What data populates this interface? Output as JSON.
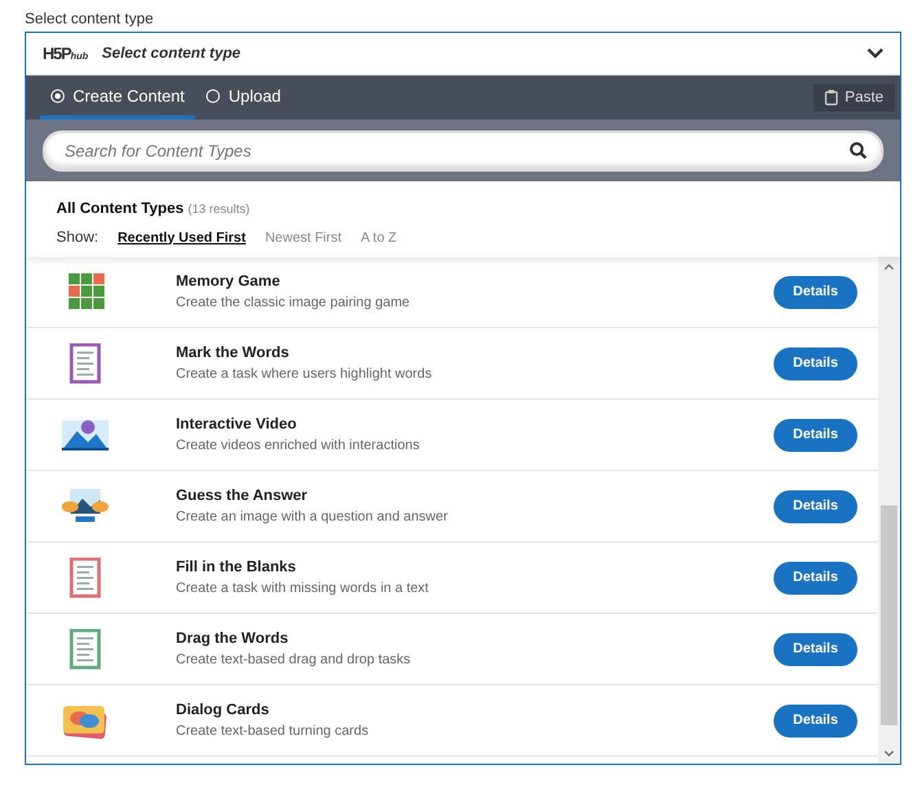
{
  "field_label": "Select content type",
  "header": {
    "logo": "H5P",
    "logo_sub": "hub",
    "title": "Select content type"
  },
  "tabs": [
    {
      "label": "Create Content",
      "selected": true
    },
    {
      "label": "Upload",
      "selected": false
    }
  ],
  "paste_button": "Paste",
  "search": {
    "placeholder": "Search for Content Types"
  },
  "results": {
    "title": "All Content Types",
    "count": "(13 results)",
    "show_label": "Show:",
    "sort_options": [
      {
        "label": "Recently Used First",
        "selected": true
      },
      {
        "label": "Newest First",
        "selected": false
      },
      {
        "label": "A to Z",
        "selected": false
      }
    ]
  },
  "items": [
    {
      "kind": "grid",
      "title": "Memory Game",
      "description": "Create the classic image pairing game",
      "button": "Details"
    },
    {
      "kind": "document",
      "color": "#9b59b6",
      "title": "Mark the Words",
      "description": "Create a task where users highlight words",
      "button": "Details"
    },
    {
      "kind": "video",
      "title": "Interactive Video",
      "description": "Create videos enriched with interactions",
      "button": "Details"
    },
    {
      "kind": "image",
      "title": "Guess the Answer",
      "description": "Create an image with a question and answer",
      "button": "Details"
    },
    {
      "kind": "document",
      "color": "#e07070",
      "title": "Fill in the Blanks",
      "description": "Create a task with missing words in a text",
      "button": "Details"
    },
    {
      "kind": "document",
      "color": "#5fae7a",
      "title": "Drag the Words",
      "description": "Create text-based drag and drop tasks",
      "button": "Details"
    },
    {
      "kind": "cards",
      "title": "Dialog Cards",
      "description": "Create text-based turning cards",
      "button": "Details"
    }
  ]
}
